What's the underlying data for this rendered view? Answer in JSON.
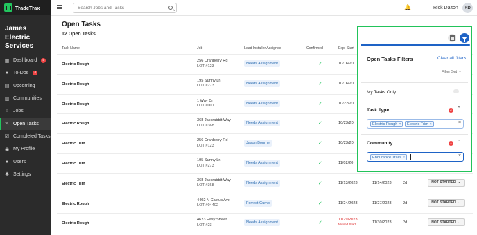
{
  "brand": {
    "name": "TradeTrax"
  },
  "company": {
    "name": "James Electric Services"
  },
  "nav": [
    {
      "label": "Dashboard",
      "icon": "dashboard-icon",
      "glyph": "▦",
      "badge": "5"
    },
    {
      "label": "To-Dos",
      "icon": "todo-icon",
      "glyph": "●",
      "badge": "4"
    },
    {
      "label": "Upcoming",
      "icon": "calendar-icon",
      "glyph": "▤",
      "badge": ""
    },
    {
      "label": "Communities",
      "icon": "communities-icon",
      "glyph": "▥",
      "badge": ""
    },
    {
      "label": "Jobs",
      "icon": "home-icon",
      "glyph": "⌂",
      "badge": ""
    },
    {
      "label": "Open Tasks",
      "icon": "wrench-icon",
      "glyph": "✎",
      "badge": "",
      "active": true
    },
    {
      "label": "Completed Tasks",
      "icon": "check-square-icon",
      "glyph": "☑",
      "badge": ""
    },
    {
      "label": "My Profile",
      "icon": "profile-icon",
      "glyph": "◉",
      "badge": ""
    },
    {
      "label": "Users",
      "icon": "users-icon",
      "glyph": "●",
      "badge": ""
    },
    {
      "label": "Settings",
      "icon": "gear-icon",
      "glyph": "✱",
      "badge": ""
    }
  ],
  "search": {
    "placeholder": "Search Jobs and Tasks"
  },
  "user": {
    "name": "Rick Dalton",
    "initials": "RD"
  },
  "page": {
    "title": "Open Tasks",
    "subtitle": "12 Open Tasks"
  },
  "table": {
    "headers": {
      "task": "Task Name",
      "job": "Job",
      "installer": "Lead Installer Assignee",
      "confirmed": "Confirmed",
      "exp_start": "Exp. Start"
    },
    "rows": [
      {
        "task": "Electric Rough",
        "job_addr": "256 Cranberry Rd",
        "job_lot": "LOT #123",
        "assignee": "Needs Assignment",
        "exp_start": "10/16/20",
        "exp_late": "",
        "end": "",
        "duration": "",
        "status": ""
      },
      {
        "task": "Electric Rough",
        "job_addr": "195 Sunny Ln",
        "job_lot": "LOT #273",
        "assignee": "Needs Assignment",
        "exp_start": "10/16/20",
        "exp_late": "",
        "end": "",
        "duration": "",
        "status": ""
      },
      {
        "task": "Electric Rough",
        "job_addr": "1 Way Dr",
        "job_lot": "LOT #001",
        "assignee": "Needs Assignment",
        "exp_start": "10/22/20",
        "exp_late": "",
        "end": "",
        "duration": "",
        "status": ""
      },
      {
        "task": "Electric Rough",
        "job_addr": "368 Jackrabbit Way",
        "job_lot": "LOT #368",
        "assignee": "Needs Assignment",
        "exp_start": "10/23/20",
        "exp_late": "",
        "end": "",
        "duration": "",
        "status": ""
      },
      {
        "task": "Electric Trim",
        "job_addr": "256 Cranberry Rd",
        "job_lot": "LOT #123",
        "assignee": "Jason Bourne",
        "exp_start": "10/23/20",
        "exp_late": "",
        "end": "",
        "duration": "",
        "status": ""
      },
      {
        "task": "Electric Trim",
        "job_addr": "195 Sunny Ln",
        "job_lot": "LOT #273",
        "assignee": "Needs Assignment",
        "exp_start": "11/02/20",
        "exp_late": "",
        "end": "",
        "duration": "",
        "status": ""
      },
      {
        "task": "Electric Trim",
        "job_addr": "368 Jackrabbit Way",
        "job_lot": "LOT #368",
        "assignee": "Needs Assignment",
        "exp_start": "11/13/2023",
        "exp_late": "",
        "end": "11/14/2023",
        "duration": "2d",
        "status": "NOT STARTED"
      },
      {
        "task": "Electric Rough",
        "job_addr": "4402 N Cactus Ave",
        "job_lot": "LOT #04402",
        "assignee": "Forrest Gump",
        "exp_start": "11/24/2023",
        "exp_late": "",
        "end": "11/27/2023",
        "duration": "2d",
        "status": "NOT STARTED"
      },
      {
        "task": "Electric Rough",
        "job_addr": "4623 Easy Street",
        "job_lot": "LOT #23",
        "assignee": "Needs Assignment",
        "exp_start": "11/29/2023",
        "exp_late": "Missed Start",
        "end": "11/30/2023",
        "duration": "2d",
        "status": "NOT STARTED"
      }
    ]
  },
  "filters": {
    "title": "Open Tasks Filters",
    "clear_all": "Clear all filters",
    "filter_set": "Filter Set",
    "my_tasks": "My Tasks Only",
    "task_type": {
      "label": "Task Type",
      "count": "2",
      "chips": [
        "Electric Rough",
        "Electric Trim"
      ]
    },
    "community": {
      "label": "Community",
      "count": "1",
      "chips": [
        "Endurance Trails"
      ]
    }
  },
  "colors": {
    "accent_green": "#22c35a",
    "primary_blue": "#1e63c6",
    "badge_red": "#ef4444"
  }
}
